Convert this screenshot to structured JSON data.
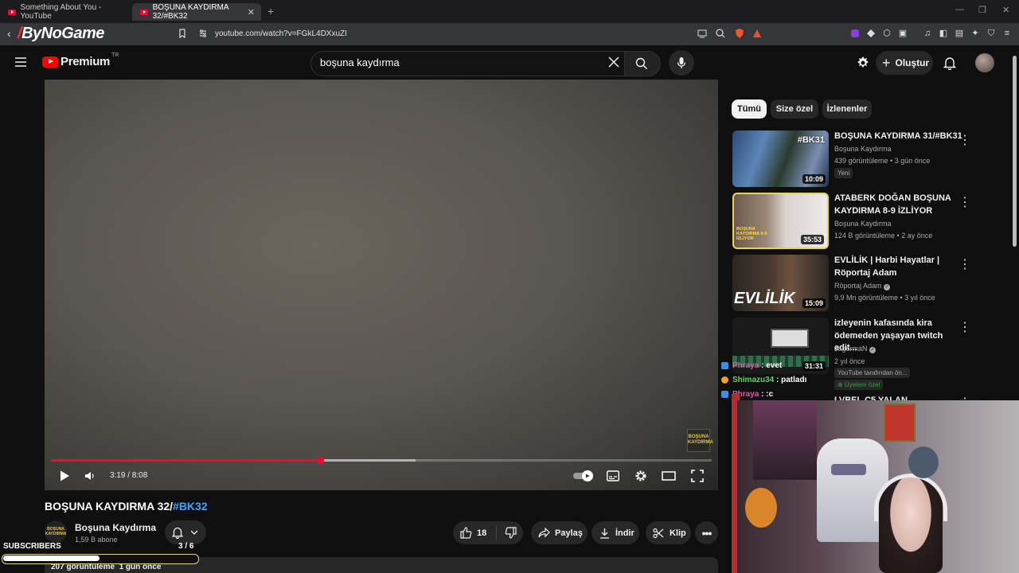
{
  "browser": {
    "tabs": [
      {
        "title": "Something About You - YouTube",
        "active": false
      },
      {
        "title": "BOŞUNA KAYDIRMA 32/#BK32",
        "active": true
      }
    ],
    "brand": "ByNoGame",
    "url": "youtube.com/watch?v=FGkL4DXxuZI"
  },
  "header": {
    "logo_text": "Premium",
    "logo_region": "TR",
    "search_query": "boşuna kaydırma",
    "create_label": "Oluştur"
  },
  "player": {
    "current_time": "3:19",
    "duration": "8:08",
    "time_display": "3:19 / 8:08",
    "progress_fraction": 0.408,
    "buffered_fraction": 0.552,
    "corner_logo": "BOŞUNA KAYDIRMA"
  },
  "video": {
    "title_main": "BOŞUNA KAYDIRMA 32/",
    "title_tag": "#BK32",
    "channel_name": "Boşuna Kaydırma",
    "channel_avatar_text": "BOŞUNA KAYDIRMA",
    "subscribers": "1,59 B abone",
    "likes": "18",
    "share_label": "Paylaş",
    "download_label": "İndir",
    "clip_label": "Klip",
    "views": "207 görüntüleme",
    "age": "1 gün önce"
  },
  "overlay": {
    "subscribers_label": "SUBSCRIBERS",
    "subscribers_progress": "3  / 6",
    "subscribers_fraction": 0.5,
    "chat": [
      {
        "user": "Phraya",
        "message": "evet",
        "user_color": "#e05aa8"
      },
      {
        "user": "Shimazu34",
        "message": "patladı",
        "user_color": "#5fd35f"
      },
      {
        "user": "Phraya",
        "message": ":c",
        "user_color": "#e05aa8"
      }
    ]
  },
  "chips": [
    "Tümü",
    "Size özel",
    "İzlenenler"
  ],
  "recommendations": [
    {
      "title": "BOŞUNA KAYDIRMA 31/#BK31",
      "channel": "Boşuna Kaydırma",
      "stats": "439 görüntüleme • 3 gün önce",
      "badge": "Yeni",
      "duration": "10:09",
      "thumb_text": "#BK31",
      "verified": false
    },
    {
      "title": "ATABERK DOĞAN BOŞUNA KAYDIRMA 8-9 İZLİYOR",
      "channel": "Boşuna Kaydırma",
      "stats": "124 B görüntüleme • 2 ay önce",
      "duration": "35:53",
      "thumb_text": "BOŞUNA KAYDIRMA 8-9 İZLİYOR",
      "verified": false
    },
    {
      "title": "EVLİLİK | Harbi Hayatlar | Röportaj Adam",
      "channel": "Röportaj Adam",
      "stats": "9,9 Mn görüntüleme • 3 yıl önce",
      "duration": "15:09",
      "thumb_text": "EVLİLİK",
      "verified": true
    },
    {
      "title": "izleyenin kafasında kira ödemeden yaşayan twitch edit...",
      "channel": "JagermaN",
      "stats": "2 yıl önce",
      "note": "YouTube tarafından ön...",
      "members_label": "Üyelere özel",
      "duration": "31:31",
      "verified": true
    },
    {
      "title": "LVBEL C5 YALAN",
      "partial": true
    }
  ],
  "colors": {
    "accent_red": "#ff0033",
    "link_blue": "#3ea6ff",
    "background": "#0f0f0f",
    "members_green": "#2ba640"
  }
}
